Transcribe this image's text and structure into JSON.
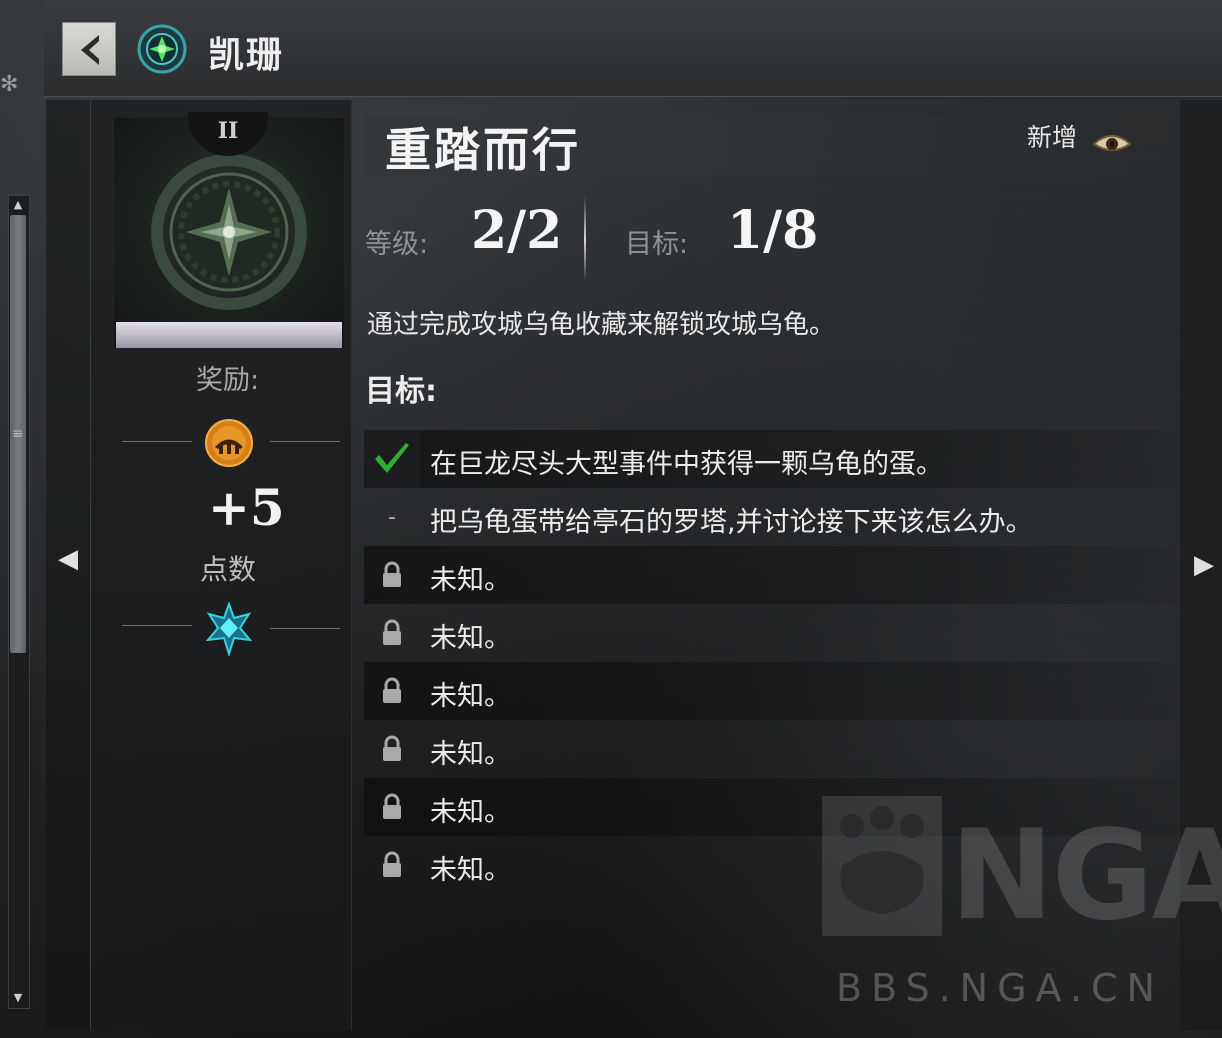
{
  "header": {
    "guild_name": "凯珊"
  },
  "badge": {
    "tier": "II",
    "reward_label": "奖励:",
    "points_value": "+5",
    "points_label": "点数"
  },
  "achievement": {
    "title": "重踏而行",
    "new_label": "新增",
    "level_label": "等级:",
    "level_value": "2/2",
    "target_label": "目标:",
    "target_value": "1/8",
    "description": "通过完成攻城乌龟收藏来解锁攻城乌龟。",
    "objectives_heading": "目标:"
  },
  "objectives": [
    {
      "text": "在巨龙尽头大型事件中获得一颗乌龟的蛋。",
      "state": "done"
    },
    {
      "text": "把乌龟蛋带给亭石的罗塔,并讨论接下来该怎么办。",
      "state": "current"
    },
    {
      "text": "未知。",
      "state": "locked"
    },
    {
      "text": "未知。",
      "state": "locked"
    },
    {
      "text": "未知。",
      "state": "locked"
    },
    {
      "text": "未知。",
      "state": "locked"
    },
    {
      "text": "未知。",
      "state": "locked"
    },
    {
      "text": "未知。",
      "state": "locked"
    }
  ],
  "watermark": {
    "logo": "NGA",
    "url": "BBS.NGA.CN"
  },
  "icons": {
    "back": "back-arrow-icon",
    "guild": "guild-emblem-icon",
    "eye": "eye-icon",
    "check": "checkmark-icon",
    "lock": "lock-icon",
    "coin": "gold-coin-icon",
    "gem": "gem-icon"
  },
  "colors": {
    "accent_check": "#2fb12f",
    "gem": "#3ad0e0",
    "coin": "#e08a1e"
  }
}
